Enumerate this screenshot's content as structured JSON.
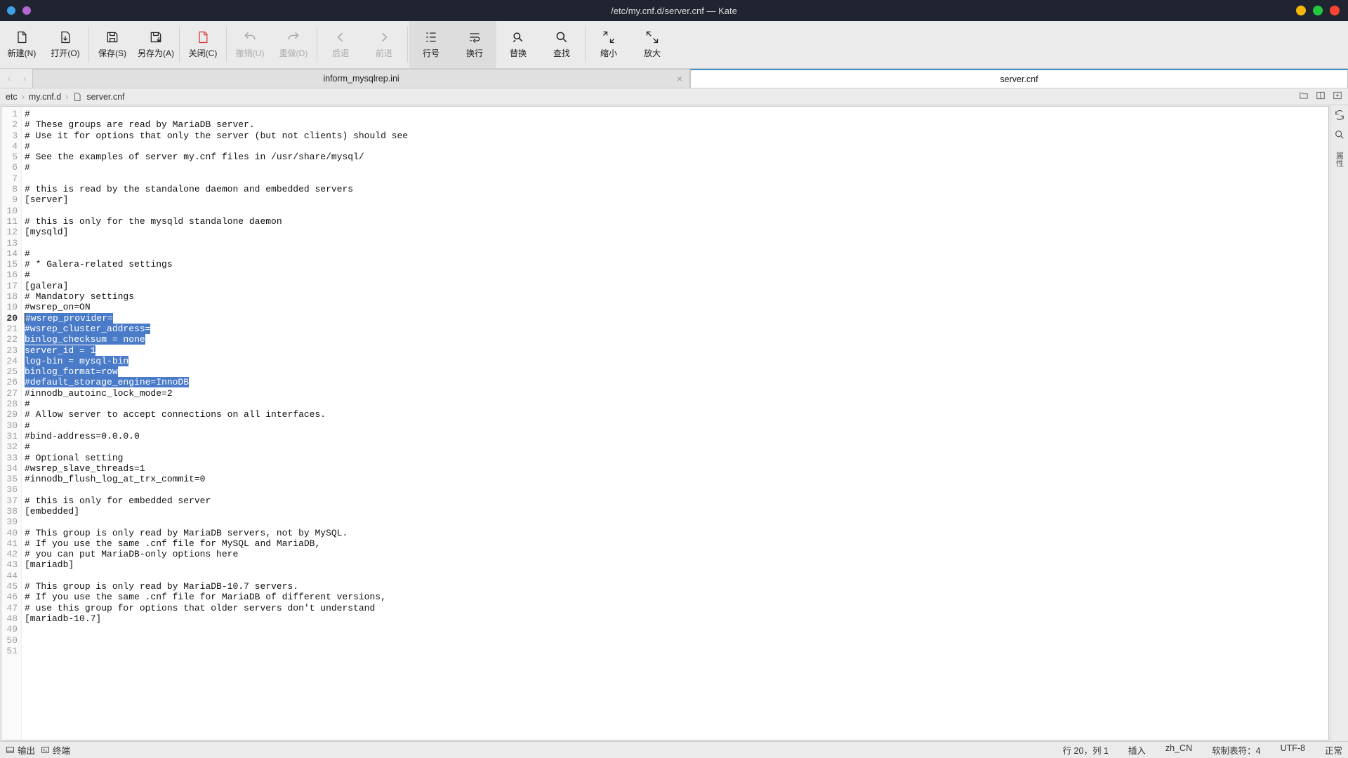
{
  "window": {
    "title": "/etc/my.cnf.d/server.cnf — Kate"
  },
  "traffic": {
    "c1": "#f5b80a",
    "c2": "#24c940",
    "c3": "#f74434"
  },
  "toolbar": {
    "new": "新建(N)",
    "open": "打开(O)",
    "save": "保存(S)",
    "saveas": "另存为(A)",
    "close": "关闭(C)",
    "undo": "撤销(U)",
    "redo": "重做(D)",
    "back": "后退",
    "fwd": "前进",
    "linenum": "行号",
    "wrap": "换行",
    "replace": "替换",
    "find": "查找",
    "shrink": "缩小",
    "enlarge": "放大"
  },
  "tabs": {
    "t1": "inform_mysqlrep.ini",
    "t2": "server.cnf"
  },
  "breadcrumb": {
    "p1": "etc",
    "p2": "my.cnf.d",
    "p3": "server.cnf"
  },
  "rightpanel": {
    "label": "属性"
  },
  "rightside_icons": {
    "openfile": "打开文件",
    "panel1": "面板",
    "panel2": "面板2",
    "diff": "差异",
    "search": "搜索"
  },
  "status": {
    "output": "输出",
    "terminal": "终端",
    "pos": "行 20，列 1",
    "mode": "插入",
    "locale": "zh_CN",
    "tabs": "软制表符：4",
    "enc": "UTF-8",
    "state": "正常"
  },
  "file": {
    "lines": [
      "#",
      "# These groups are read by MariaDB server.",
      "# Use it for options that only the server (but not clients) should see",
      "#",
      "# See the examples of server my.cnf files in /usr/share/mysql/",
      "#",
      "",
      "# this is read by the standalone daemon and embedded servers",
      "[server]",
      "",
      "# this is only for the mysqld standalone daemon",
      "[mysqld]",
      "",
      "#",
      "# * Galera-related settings",
      "#",
      "[galera]",
      "# Mandatory settings",
      "#wsrep_on=ON",
      "#wsrep_provider=",
      "#wsrep_cluster_address=",
      "binlog_checksum = none",
      "server_id = 1",
      "log-bin = mysql-bin",
      "binlog_format=row",
      "#default_storage_engine=InnoDB",
      "#innodb_autoinc_lock_mode=2",
      "#",
      "# Allow server to accept connections on all interfaces.",
      "#",
      "#bind-address=0.0.0.0",
      "#",
      "# Optional setting",
      "#wsrep_slave_threads=1",
      "#innodb_flush_log_at_trx_commit=0",
      "",
      "# this is only for embedded server",
      "[embedded]",
      "",
      "# This group is only read by MariaDB servers, not by MySQL.",
      "# If you use the same .cnf file for MySQL and MariaDB,",
      "# you can put MariaDB-only options here",
      "[mariadb]",
      "",
      "# This group is only read by MariaDB-10.7 servers.",
      "# If you use the same .cnf file for MariaDB of different versions,",
      "# use this group for options that older servers don't understand",
      "[mariadb-10.7]",
      "",
      "",
      ""
    ],
    "current_line": 20,
    "selection": {
      "start": 20,
      "end": 26
    }
  }
}
